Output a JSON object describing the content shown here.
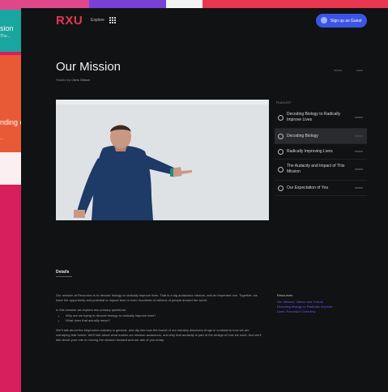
{
  "background_cards": [
    {
      "title": "sion",
      "subtitle": "The..."
    },
    {
      "title": "nding es",
      "subtitle": "..."
    }
  ],
  "nav": {
    "logo": "RXU",
    "explore_label": "Explore",
    "cta_label": "Sign up as Guest"
  },
  "page": {
    "title": "Our Mission",
    "hosted_by_label": "Hosted by",
    "host_name": "Chris Gibson"
  },
  "video": {
    "progress": 0
  },
  "playlist": {
    "heading": "PLAYLIST",
    "items": [
      {
        "label": "Decoding Biology to Radically Improve Lives",
        "active": false
      },
      {
        "label": "Decoding Biology",
        "active": true
      },
      {
        "label": "Radically Improving Lives",
        "active": false
      },
      {
        "label": "The Audacity and Impact of This Mission",
        "active": false
      },
      {
        "label": "Our Expectation of You",
        "active": false
      }
    ]
  },
  "details": {
    "heading": "Details",
    "paragraphs": [
      "Our mission at Recursion is to decode biology to radically improve lives. That is a big audacious mission, and an important one. Together, we have the opportunity and potential to impact tens or even hundreds of millions of people around the world.",
      "In this session we explore two primary questions:"
    ],
    "bullets": [
      "Why are we trying to decode biology to radically improve lives?",
      "What does that actually mean?"
    ],
    "closing": "We'll talk about the biopharma industry in general, and dig into how the funnel of our industry discovers drugs in contrast to how we are reshaping that funnel. We'll talk about what makes our mission audacious, and why that audacity is part of the design of how we work. And we'll talk about your role in moving the mission forward and our ask of you today."
  },
  "resources": {
    "heading": "Resources",
    "links": [
      "Our Mission, Values and Culture",
      "Decoding Biology to Radically Improve",
      "Lives: Recursion Overview"
    ]
  },
  "colors": {
    "brand": "#e8364f",
    "accent": "#3b55e6",
    "link": "#6b5cf0",
    "page_bg": "#111214"
  }
}
